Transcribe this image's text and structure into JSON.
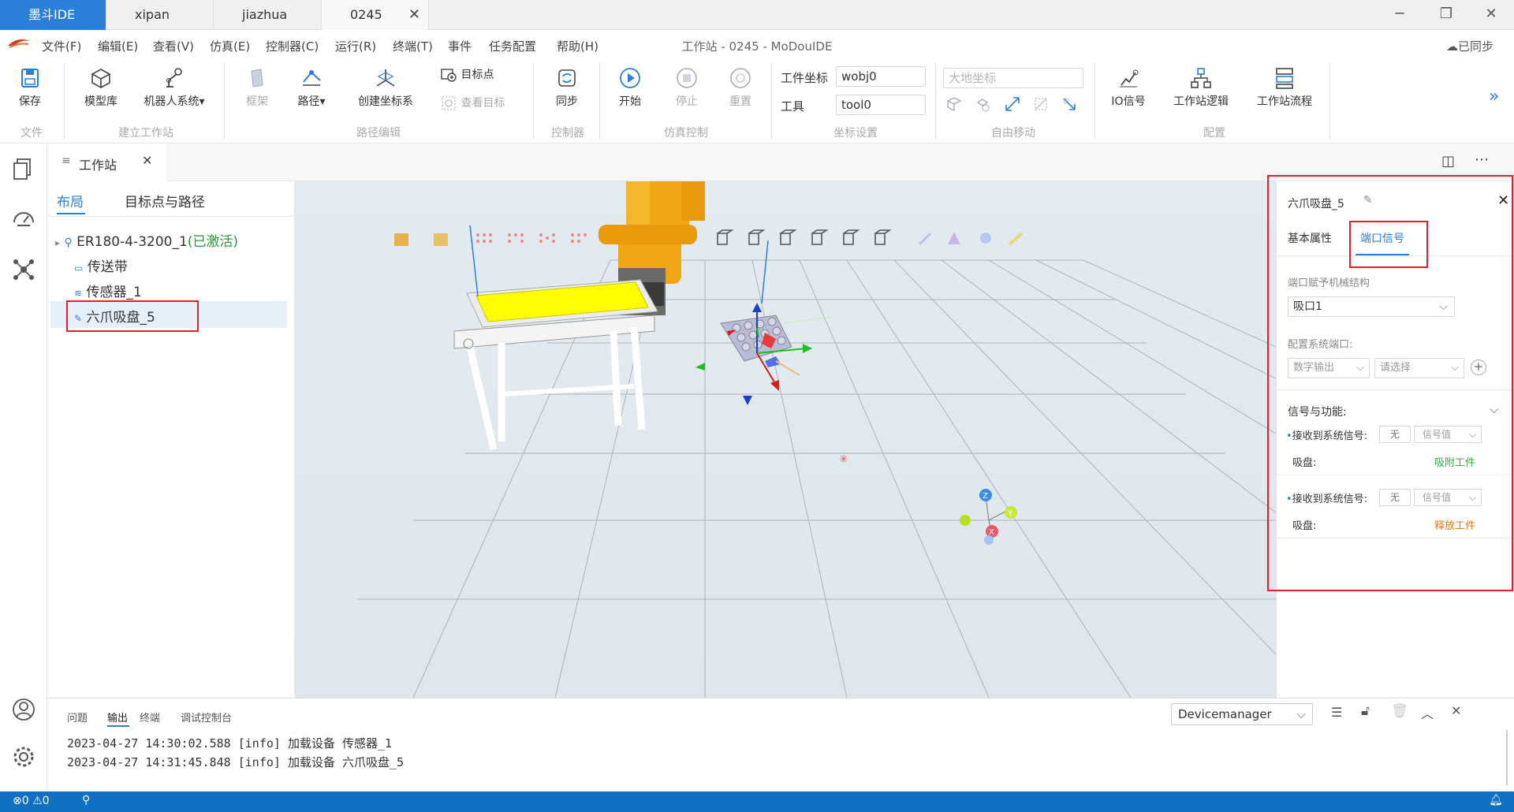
{
  "tabs": [
    {
      "label": "墨斗IDE",
      "active": true
    },
    {
      "label": "xipan"
    },
    {
      "label": "jiazhua"
    },
    {
      "label": "0245",
      "closable": true
    }
  ],
  "window_controls": [
    "minimize-icon",
    "restore-icon",
    "close-icon"
  ],
  "menu": [
    "文件(F)",
    "编辑(E)",
    "查看(V)",
    "仿真(E)",
    "控制器(C)",
    "运行(R)",
    "终端(T)",
    "事件",
    "任务配置",
    "帮助(H)"
  ],
  "app_title": "工作站 - 0245 - MoDouIDE",
  "sync_status": "已同步",
  "ribbon": {
    "save": "保存",
    "model_lib": "模型库",
    "robot_system": "机器人系统▾",
    "frame": "框架",
    "path": "路径▾",
    "create_coord": "创建坐标系",
    "target_point": "目标点",
    "view_target": "查看目标",
    "sync": "同步",
    "start": "开始",
    "stop": "停止",
    "reset": "重置",
    "workobj_label": "工件坐标",
    "workobj_value": "wobj0",
    "tool_label": "工具",
    "tool_value": "tool0",
    "ground_coord_placeholder": "大地坐标",
    "io_signal": "IO信号",
    "station_logic": "工作站逻辑",
    "station_flow": "工作站流程",
    "groups": [
      "文件",
      "建立工作站",
      "路径编辑",
      "控制器",
      "仿真控制",
      "坐标设置",
      "自由移动",
      "配置"
    ]
  },
  "panel": {
    "tab_title": "工作站",
    "subtabs": [
      "布局",
      "目标点与路径"
    ],
    "tree": [
      {
        "label": "ER180-4-3200_1",
        "status": "(已激活)"
      },
      {
        "label": "传送带"
      },
      {
        "label": "传感器_1"
      },
      {
        "label": "六爪吸盘_5"
      }
    ]
  },
  "prop_panel": {
    "title": "六爪吸盘_5",
    "tabs": [
      "基本属性",
      "端口信号"
    ],
    "assign_label": "端口赋予机械结构",
    "assign_value": "吸口1",
    "config_label": "配置系统端口:",
    "port_type": "数字输出",
    "port_select_placeholder": "请选择",
    "signals_label": "信号与功能:",
    "rows": [
      {
        "recv_label": "接收到系统信号:",
        "none": "无",
        "signal_value": "信号值",
        "func_label": "吸盘:",
        "func_value": "吸附工件",
        "func_color": "#3aa841"
      },
      {
        "recv_label": "接收到系统信号:",
        "none": "无",
        "signal_value": "信号值",
        "func_label": "吸盘:",
        "func_value": "释放工件",
        "func_color": "#e07a1c"
      }
    ]
  },
  "output": {
    "tabs": [
      "问题",
      "输出",
      "终端",
      "调试控制台"
    ],
    "active_tab": "输出",
    "channel": "Devicemanager",
    "logs": [
      "2023-04-27 14:30:02.588 [info] 加载设备 传感器_1",
      "2023-04-27 14:31:45.848 [info] 加载设备 六爪吸盘_5"
    ]
  },
  "statusbar": {
    "errors": "0",
    "warnings": "0"
  },
  "colors": {
    "accent": "#2c7fd8",
    "statusbar": "#1071c4",
    "highlight": "#e0202a"
  }
}
